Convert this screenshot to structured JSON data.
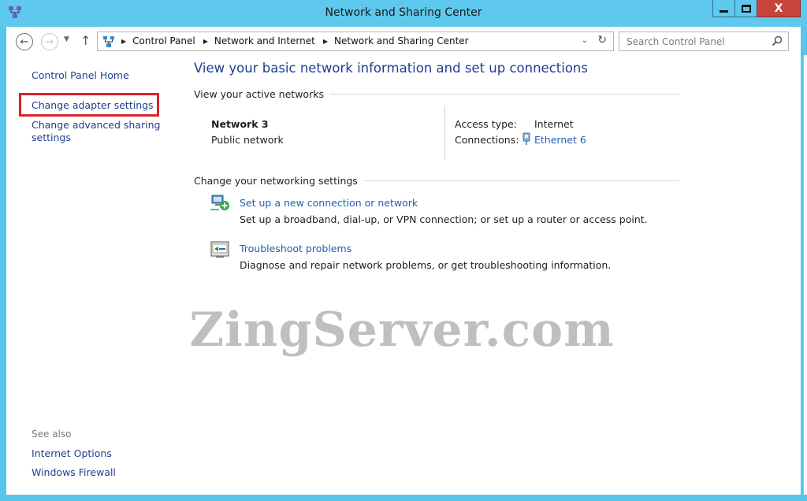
{
  "window": {
    "title": "Network and Sharing Center",
    "close_glyph": "X"
  },
  "navigation": {
    "back_icon": "back-arrow-icon",
    "forward_icon": "forward-arrow-icon",
    "up_icon": "up-arrow-icon",
    "breadcrumbs": [
      "Control Panel",
      "Network and Internet",
      "Network and Sharing Center"
    ],
    "search_placeholder": "Search Control Panel"
  },
  "left_pane": {
    "home_link": "Control Panel Home",
    "adapter_link": "Change adapter settings",
    "advanced_link": "Change advanced sharing settings",
    "see_also_label": "See also",
    "see_also_links": [
      "Internet Options",
      "Windows Firewall"
    ]
  },
  "main": {
    "title": "View your basic network information and set up connections",
    "active_networks_header": "View your active networks",
    "network": {
      "name": "Network  3",
      "type": "Public network",
      "access_type_label": "Access type:",
      "access_type_value": "Internet",
      "connections_label": "Connections:",
      "connections_value": "Ethernet 6"
    },
    "change_settings_header": "Change your networking settings",
    "tasks": [
      {
        "link": "Set up a new connection or network",
        "description": "Set up a broadband, dial-up, or VPN connection; or set up a router or access point."
      },
      {
        "link": "Troubleshoot problems",
        "description": "Diagnose and repair network problems, or get troubleshooting information."
      }
    ]
  },
  "watermark": "ZingServer.com",
  "colors": {
    "chrome": "#5fc8ee",
    "link": "#1e3f8f",
    "task_link": "#1e5fb4",
    "highlight": "#d8232a",
    "close_button": "#c7443b"
  }
}
